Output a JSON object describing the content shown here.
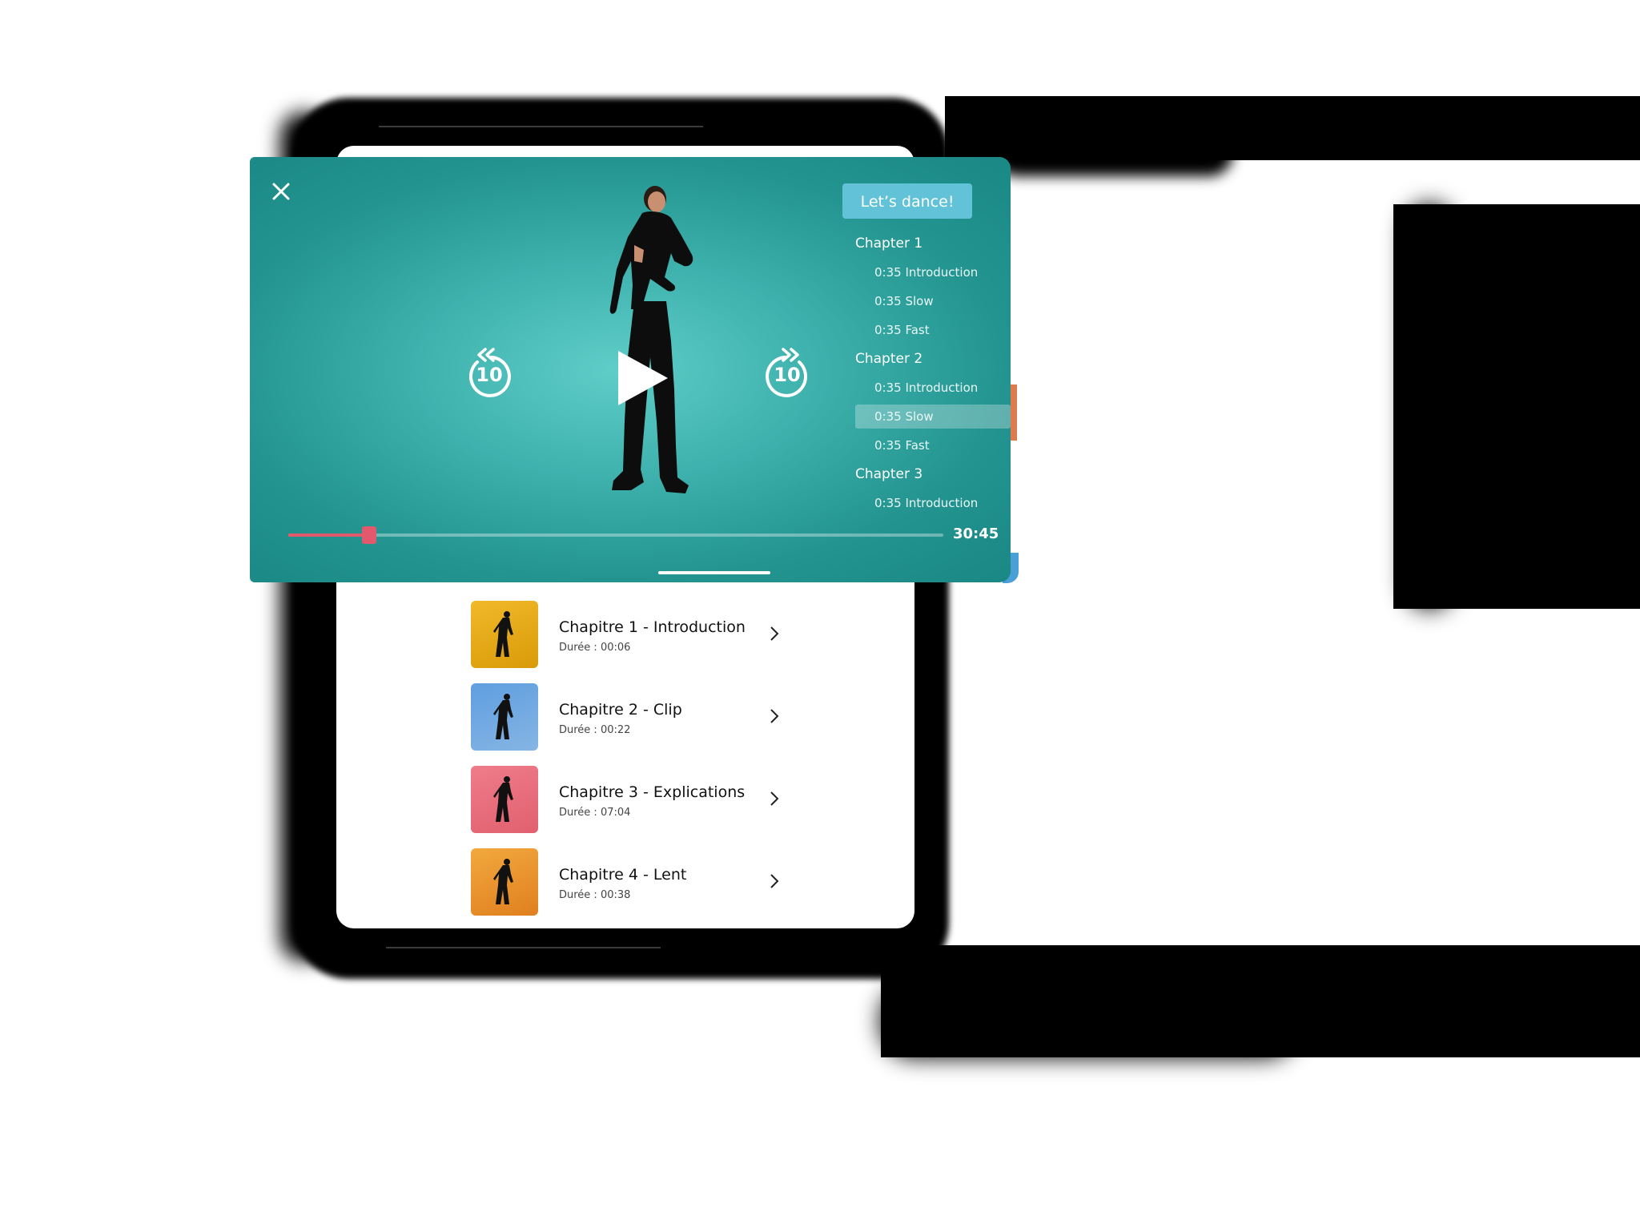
{
  "player": {
    "cta_label": "Let’s dance!",
    "time": "30:45",
    "skip_back_label": "10",
    "skip_forward_label": "10",
    "progress": 0.123,
    "accent_color": "#e2596d",
    "background_color": "#2aa29e",
    "chapters": [
      {
        "title": "Chapter 1",
        "items": [
          {
            "label": "0:35 Introduction",
            "active": false
          },
          {
            "label": "0:35 Slow",
            "active": false
          },
          {
            "label": "0:35 Fast",
            "active": false
          }
        ]
      },
      {
        "title": "Chapter 2",
        "items": [
          {
            "label": "0:35 Introduction",
            "active": false
          },
          {
            "label": "0:35 Slow",
            "active": true
          },
          {
            "label": "0:35 Fast",
            "active": false
          }
        ]
      },
      {
        "title": "Chapter 3",
        "items": [
          {
            "label": "0:35 Introduction",
            "active": false
          }
        ]
      }
    ]
  },
  "list": {
    "items": [
      {
        "title": "Chapitre 1 - Introduction",
        "subtitle": "Durée : 00:06",
        "color_top": "#f1b92a",
        "color_bottom": "#d99a08"
      },
      {
        "title": "Chapitre 2 - Clip",
        "subtitle": "Durée : 00:22",
        "color_top": "#5e9ee0",
        "color_bottom": "#86b5e4"
      },
      {
        "title": "Chapitre 3 - Explications",
        "subtitle": "Durée : 07:04",
        "color_top": "#ef7c8a",
        "color_bottom": "#e1606f"
      },
      {
        "title": "Chapitre 4 - Lent",
        "subtitle": "Durée : 00:38",
        "color_top": "#f2a93e",
        "color_bottom": "#e07f1f"
      }
    ]
  }
}
